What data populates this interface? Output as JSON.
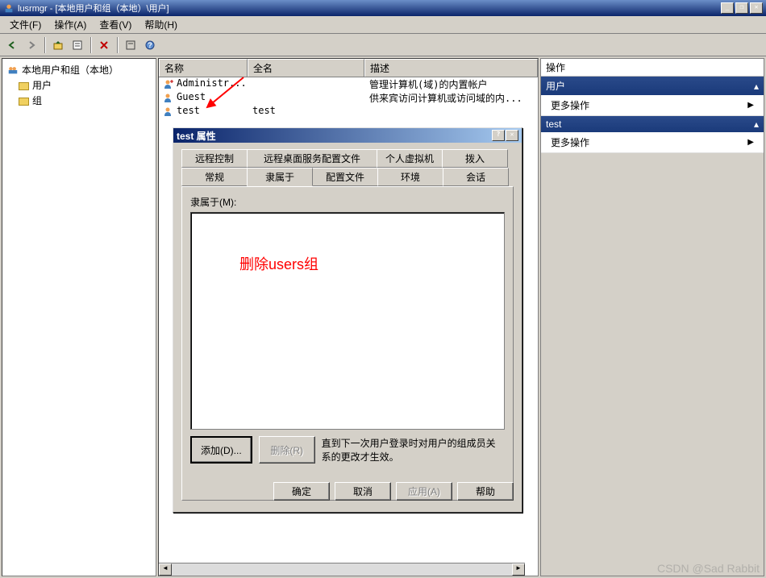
{
  "window": {
    "title": "lusrmgr - [本地用户和组（本地）\\用户]"
  },
  "menu": {
    "file": "文件(F)",
    "action": "操作(A)",
    "view": "查看(V)",
    "help": "帮助(H)"
  },
  "tree": {
    "root": "本地用户和组（本地）",
    "users": "用户",
    "groups": "组"
  },
  "grid": {
    "columns": {
      "name": "名称",
      "fullname": "全名",
      "desc": "描述"
    },
    "rows": [
      {
        "name": "Administr...",
        "full": "",
        "desc": "管理计算机(域)的内置帐户"
      },
      {
        "name": "Guest",
        "full": "",
        "desc": "供来宾访问计算机或访问域的内..."
      },
      {
        "name": "test",
        "full": "test",
        "desc": ""
      }
    ]
  },
  "actions": {
    "header": "操作",
    "group1": "用户",
    "more": "更多操作",
    "group2": "test"
  },
  "dialog": {
    "title": "test 属性",
    "tabs_row1": [
      "远程控制",
      "远程桌面服务配置文件",
      "个人虚拟机",
      "拨入"
    ],
    "tabs_row2": [
      "常规",
      "隶属于",
      "配置文件",
      "环境",
      "会话"
    ],
    "member_label": "隶属于(M):",
    "add": "添加(D)...",
    "remove": "删除(R)",
    "note": "直到下一次用户登录时对用户的组成员关系的更改才生效。",
    "ok": "确定",
    "cancel": "取消",
    "apply": "应用(A)",
    "help": "帮助"
  },
  "annotation": "删除users组",
  "watermark": "CSDN @Sad Rabbit"
}
